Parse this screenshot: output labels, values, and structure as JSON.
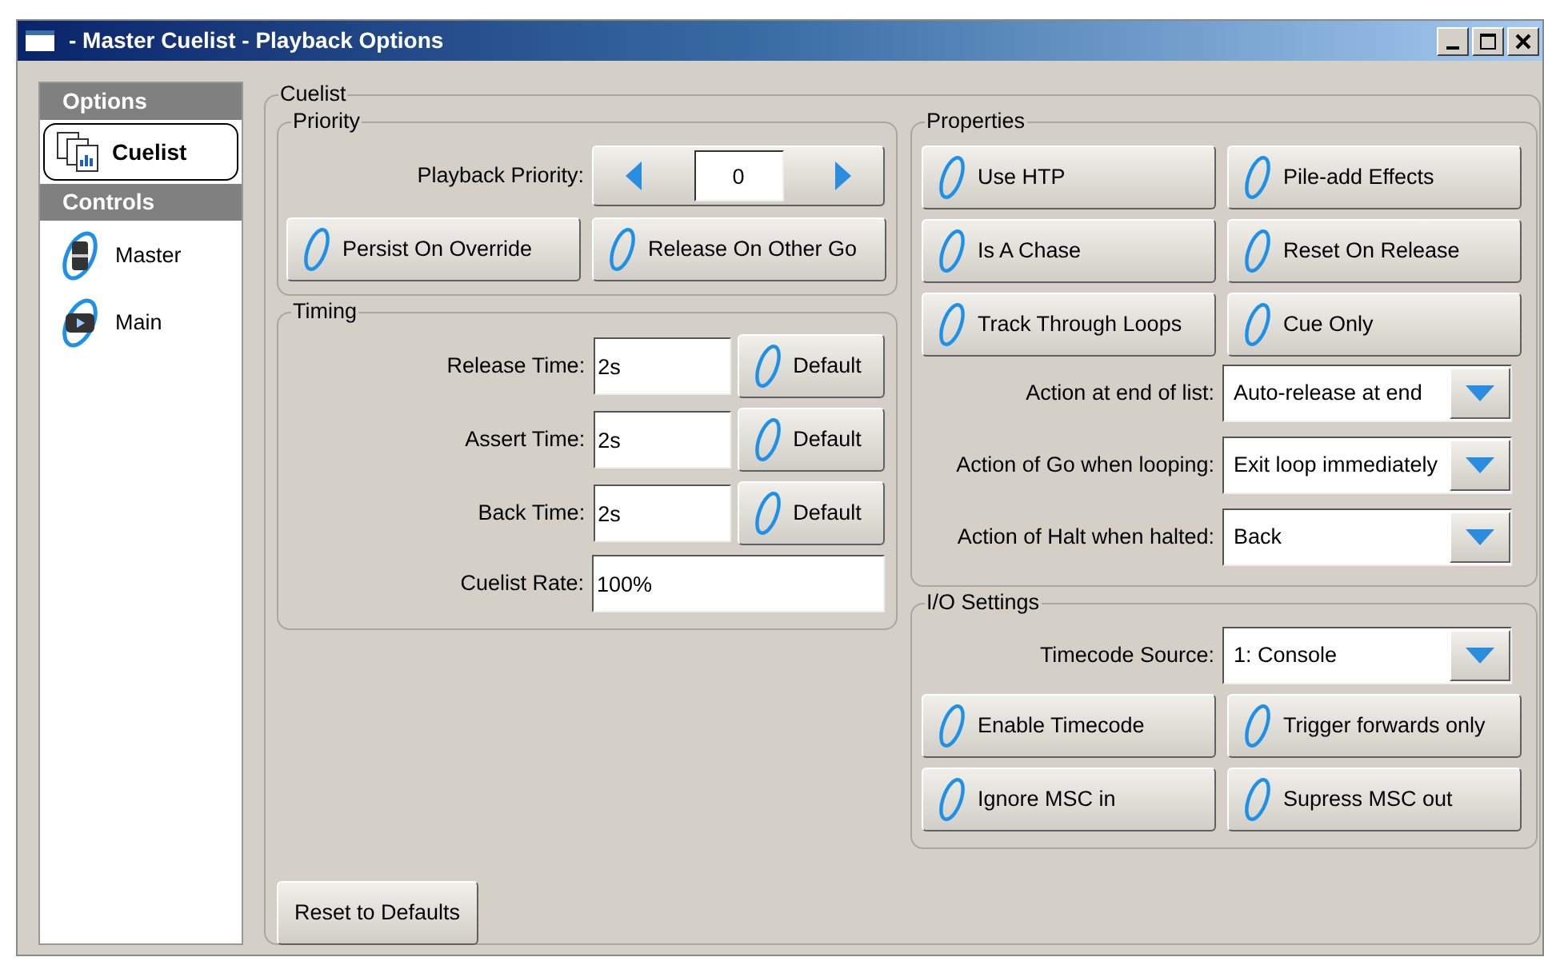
{
  "window": {
    "title": "- Master Cuelist - Playback Options"
  },
  "sidebar": {
    "sections": [
      {
        "heading": "Options",
        "items": [
          {
            "label": "Cuelist",
            "kind": "cuelist",
            "selected": true
          }
        ]
      },
      {
        "heading": "Controls",
        "items": [
          {
            "label": "Master",
            "kind": "fader",
            "selected": false
          },
          {
            "label": "Main",
            "kind": "play",
            "selected": false
          }
        ]
      }
    ]
  },
  "cuelist": {
    "title": "Cuelist",
    "priority": {
      "title": "Priority",
      "label": "Playback Priority:",
      "value": "0",
      "toggles": [
        "Persist On Override",
        "Release On Other Go"
      ]
    },
    "timing": {
      "title": "Timing",
      "fields": [
        {
          "label": "Release Time:",
          "value": "2s",
          "button": "Default"
        },
        {
          "label": "Assert Time:",
          "value": "2s",
          "button": "Default"
        },
        {
          "label": "Back Time:",
          "value": "2s",
          "button": "Default"
        },
        {
          "label": "Cuelist Rate:",
          "value": "100%"
        }
      ]
    },
    "properties": {
      "title": "Properties",
      "toggles": [
        "Use HTP",
        "Pile-add Effects",
        "Is A Chase",
        "Reset On Release",
        "Track Through Loops",
        "Cue Only"
      ],
      "selects": [
        {
          "label": "Action at end of list:",
          "value": "Auto-release at end"
        },
        {
          "label": "Action of Go when looping:",
          "value": "Exit loop immediately"
        },
        {
          "label": "Action of Halt when halted:",
          "value": "Back"
        }
      ]
    },
    "io": {
      "title": "I/O Settings",
      "selects": [
        {
          "label": "Timecode Source:",
          "value": "1: Console"
        }
      ],
      "toggles": [
        "Enable Timecode",
        "Trigger forwards only",
        "Ignore MSC in",
        "Supress MSC out"
      ]
    },
    "reset_button": "Reset to Defaults"
  }
}
